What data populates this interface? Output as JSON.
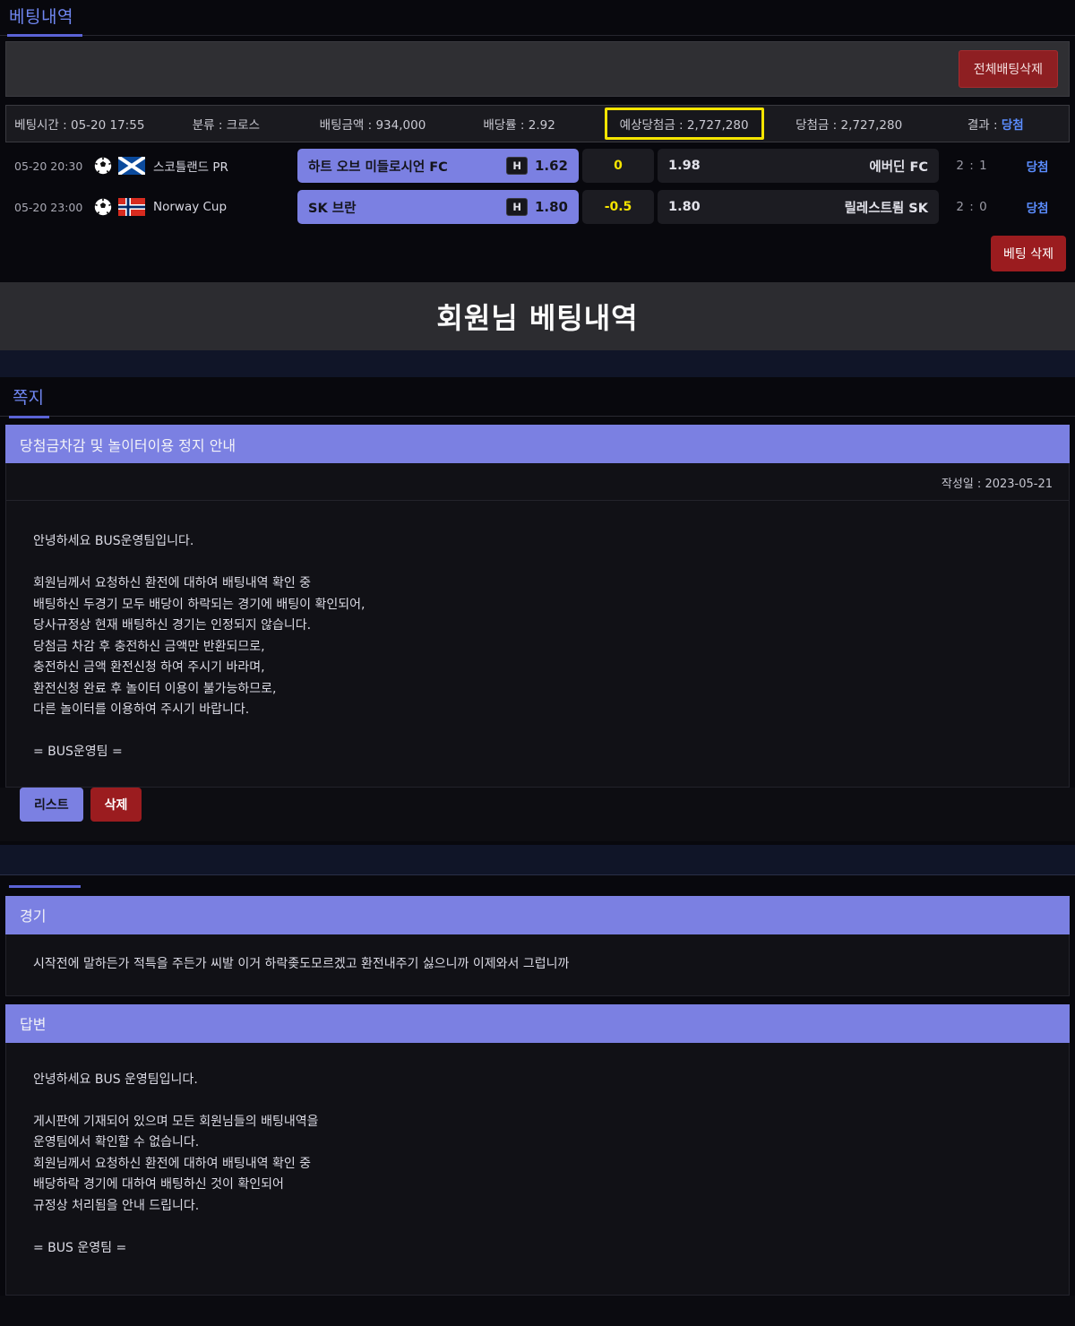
{
  "betting": {
    "tab_label": "베팅내역",
    "delete_all_label": "전체배팅삭제",
    "delete_bet_label": "베팅 삭제",
    "summary": {
      "time_label": "베팅시간 : 05-20 17:55",
      "type_label": "분류 : 크로스",
      "amount_label": "배팅금액 : 934,000",
      "odds_label": "배당률 : 2.92",
      "expected_label": "예상당첨금 : 2,727,280",
      "payout_label": "당첨금 : 2,727,280",
      "result_prefix": "결과 : ",
      "result_value": "당첨",
      "highlight_color": "#f5e400"
    },
    "matches": [
      {
        "time": "05-20 20:30",
        "sport_icon": "soccer-ball-icon",
        "flag": "scotland-flag-icon",
        "league": "스코틀랜드 PR",
        "pick_team": "하트 오브 미들로시언 FC",
        "pick_badge": "H",
        "pick_odds": "1.62",
        "handicap": "0",
        "opp_odds": "1.98",
        "opp_team": "에버딘 FC",
        "score": "2 : 1",
        "result": "당첨"
      },
      {
        "time": "05-20 23:00",
        "sport_icon": "soccer-ball-icon",
        "flag": "norway-flag-icon",
        "league": "Norway Cup",
        "pick_team": "SK 브란",
        "pick_badge": "H",
        "pick_odds": "1.80",
        "handicap": "-0.5",
        "opp_odds": "1.80",
        "opp_team": "릴레스트룀 SK",
        "score": "2 : 0",
        "result": "당첨"
      }
    ]
  },
  "page_title": "회원님 베팅내역",
  "note": {
    "tab_label": "쪽지",
    "subject": "당첨금차감 및 놀이터이용 정지 안내",
    "date_label": "작성일 : 2023-05-21",
    "body": "안녕하세요 BUS운영팀입니다.\n\n회원님께서 요청하신 환전에 대하여 배팅내역 확인 중\n배팅하신 두경기 모두 배당이 하락되는 경기에 배팅이 확인되어,\n당사규정상 현재 배팅하신 경기는 인정되지 않습니다.\n당첨금 차감 후 충전하신 금액만 반환되므로,\n충전하신 금액 환전신청 하여 주시기 바라며,\n환전신청 완료 후 놀이터 이용이 불가능하므로,\n다른 놀이터를 이용하여 주시기 바랍니다.\n\n= BUS운영팀 =",
    "list_button": "리스트",
    "delete_button": "삭제"
  },
  "qna": {
    "question_header": "경기",
    "question_body": "시작전에 말하든가 적특을 주든가 씨발 이거 하락좆도모르겠고 환전내주기 싫으니까 이제와서 그럽니까",
    "answer_header": "답변",
    "answer_body": "안녕하세요 BUS 운영팀입니다.\n\n게시판에 기재되어 있으며 모든 회원님들의 배팅내역을\n운영팀에서 확인할 수 없습니다.\n회원님께서 요청하신 환전에 대하여 배팅내역 확인 중\n배당하락 경기에 대하여 배팅하신 것이 확인되어\n규정상 처리됨을 안내 드립니다.\n\n= BUS 운영팀 ="
  }
}
